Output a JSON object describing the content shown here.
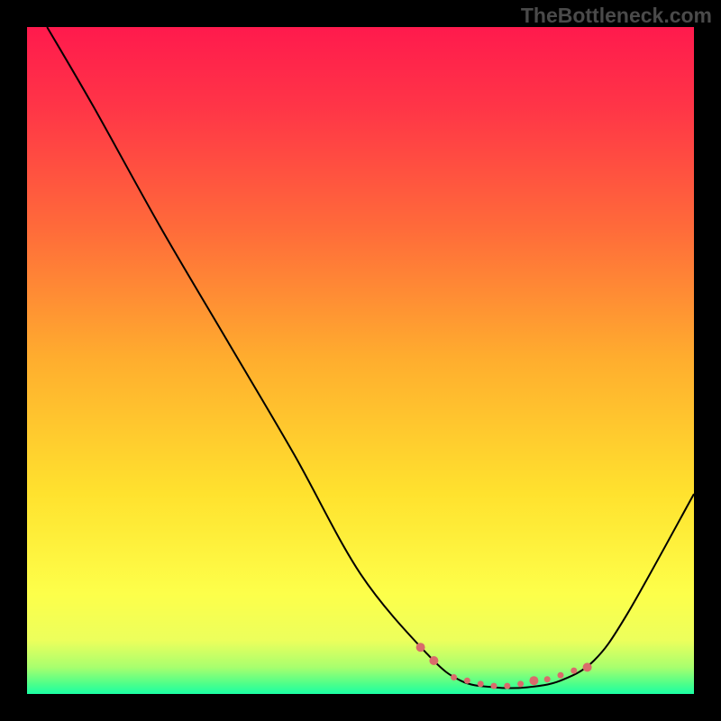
{
  "attribution": "TheBottleneck.com",
  "chart_data": {
    "type": "line",
    "title": "",
    "xlabel": "",
    "ylabel": "",
    "xlim": [
      0,
      100
    ],
    "ylim": [
      0,
      100
    ],
    "series": [
      {
        "name": "bottleneck-curve",
        "x": [
          3,
          10,
          20,
          30,
          40,
          50,
          60,
          65,
          70,
          75,
          80,
          85,
          90,
          100
        ],
        "y": [
          100,
          88,
          70,
          53,
          36,
          18,
          6,
          2,
          1,
          1,
          2,
          5,
          12,
          30
        ],
        "color": "#000000"
      }
    ],
    "markers": {
      "name": "highlight-dots",
      "x": [
        59,
        61,
        76,
        84,
        64,
        66,
        68,
        70,
        72,
        74,
        78,
        80,
        82
      ],
      "y": [
        7,
        5,
        2,
        4,
        2.5,
        2,
        1.5,
        1.2,
        1.2,
        1.5,
        2.2,
        2.8,
        3.5
      ],
      "color": "#d96b6b",
      "sizes": [
        5,
        5,
        5,
        5,
        3.5,
        3.5,
        3.5,
        3.5,
        3.5,
        3.5,
        3.5,
        3.5,
        3.5
      ]
    },
    "background_gradient": {
      "type": "vertical",
      "stops": [
        {
          "offset": 0,
          "color": "#ff1a4d"
        },
        {
          "offset": 0.12,
          "color": "#ff3547"
        },
        {
          "offset": 0.3,
          "color": "#ff6a3a"
        },
        {
          "offset": 0.5,
          "color": "#ffae2e"
        },
        {
          "offset": 0.7,
          "color": "#ffe22e"
        },
        {
          "offset": 0.85,
          "color": "#fdff4a"
        },
        {
          "offset": 0.92,
          "color": "#ecff5c"
        },
        {
          "offset": 0.96,
          "color": "#a8ff6e"
        },
        {
          "offset": 0.985,
          "color": "#4dff8a"
        },
        {
          "offset": 1,
          "color": "#1bffa5"
        }
      ]
    }
  }
}
